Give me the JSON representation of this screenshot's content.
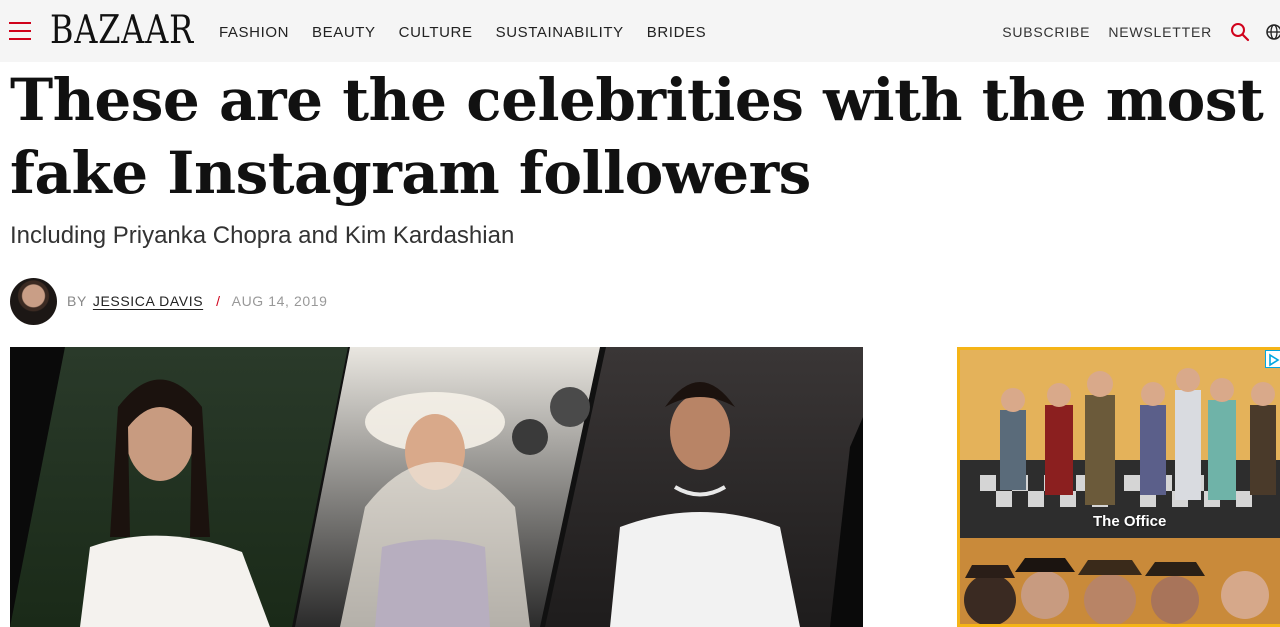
{
  "header": {
    "logo": "BAZAAR",
    "nav": [
      "FASHION",
      "BEAUTY",
      "CULTURE",
      "SUSTAINABILITY",
      "BRIDES"
    ],
    "subscribe": "SUBSCRIBE",
    "newsletter": "NEWSLETTER",
    "brand_color": "#d0021b"
  },
  "article": {
    "title": "These are the celebrities with the most fake Instagram followers",
    "dek": "Including Priyanka Chopra and Kim Kardashian",
    "by_label": "BY",
    "author": "JESSICA DAVIS",
    "separator": "/",
    "date": "AUG 14, 2019"
  },
  "ad": {
    "title": "The Office",
    "border_color": "#f5b417"
  }
}
